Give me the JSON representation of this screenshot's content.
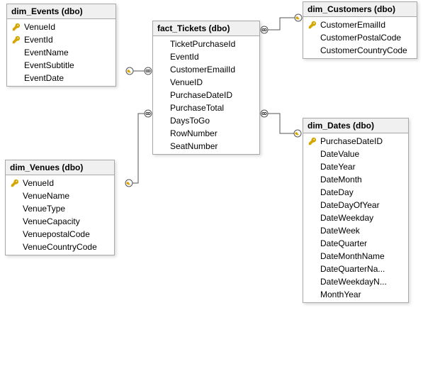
{
  "tables": {
    "events": {
      "title": "dim_Events (dbo)",
      "columns": [
        {
          "name": "VenueId",
          "pk": true
        },
        {
          "name": "EventId",
          "pk": true
        },
        {
          "name": "EventName",
          "pk": false
        },
        {
          "name": "EventSubtitle",
          "pk": false
        },
        {
          "name": "EventDate",
          "pk": false
        }
      ]
    },
    "tickets": {
      "title": "fact_Tickets (dbo)",
      "columns": [
        {
          "name": "TicketPurchaseId",
          "pk": false
        },
        {
          "name": "EventId",
          "pk": false
        },
        {
          "name": "CustomerEmailId",
          "pk": false
        },
        {
          "name": "VenueID",
          "pk": false
        },
        {
          "name": "PurchaseDateID",
          "pk": false
        },
        {
          "name": "PurchaseTotal",
          "pk": false
        },
        {
          "name": "DaysToGo",
          "pk": false
        },
        {
          "name": "RowNumber",
          "pk": false
        },
        {
          "name": "SeatNumber",
          "pk": false
        }
      ]
    },
    "customers": {
      "title": "dim_Customers (dbo)",
      "columns": [
        {
          "name": "CustomerEmailId",
          "pk": true
        },
        {
          "name": "CustomerPostalCode",
          "pk": false
        },
        {
          "name": "CustomerCountryCode",
          "pk": false
        }
      ]
    },
    "venues": {
      "title": "dim_Venues (dbo)",
      "columns": [
        {
          "name": "VenueId",
          "pk": true
        },
        {
          "name": "VenueName",
          "pk": false
        },
        {
          "name": "VenueType",
          "pk": false
        },
        {
          "name": "VenueCapacity",
          "pk": false
        },
        {
          "name": "VenuepostalCode",
          "pk": false
        },
        {
          "name": "VenueCountryCode",
          "pk": false
        }
      ]
    },
    "dates": {
      "title": "dim_Dates (dbo)",
      "columns": [
        {
          "name": "PurchaseDateID",
          "pk": true
        },
        {
          "name": "DateValue",
          "pk": false
        },
        {
          "name": "DateYear",
          "pk": false
        },
        {
          "name": "DateMonth",
          "pk": false
        },
        {
          "name": "DateDay",
          "pk": false
        },
        {
          "name": "DateDayOfYear",
          "pk": false
        },
        {
          "name": "DateWeekday",
          "pk": false
        },
        {
          "name": "DateWeek",
          "pk": false
        },
        {
          "name": "DateQuarter",
          "pk": false
        },
        {
          "name": "DateMonthName",
          "pk": false
        },
        {
          "name": "DateQuarterNa...",
          "pk": false
        },
        {
          "name": "DateWeekdayN...",
          "pk": false
        },
        {
          "name": "MonthYear",
          "pk": false
        }
      ]
    }
  },
  "relations": [
    {
      "from": "tickets",
      "to": "events"
    },
    {
      "from": "tickets",
      "to": "customers"
    },
    {
      "from": "tickets",
      "to": "venues"
    },
    {
      "from": "tickets",
      "to": "dates"
    }
  ],
  "chart_data": {
    "type": "table",
    "description": "Star-schema ER diagram: fact_Tickets in center linked to four dimension tables.",
    "tables": [
      {
        "name": "dim_Events",
        "schema": "dbo",
        "pk": [
          "VenueId",
          "EventId"
        ],
        "columns": [
          "VenueId",
          "EventId",
          "EventName",
          "EventSubtitle",
          "EventDate"
        ]
      },
      {
        "name": "fact_Tickets",
        "schema": "dbo",
        "pk": [],
        "columns": [
          "TicketPurchaseId",
          "EventId",
          "CustomerEmailId",
          "VenueID",
          "PurchaseDateID",
          "PurchaseTotal",
          "DaysToGo",
          "RowNumber",
          "SeatNumber"
        ]
      },
      {
        "name": "dim_Customers",
        "schema": "dbo",
        "pk": [
          "CustomerEmailId"
        ],
        "columns": [
          "CustomerEmailId",
          "CustomerPostalCode",
          "CustomerCountryCode"
        ]
      },
      {
        "name": "dim_Venues",
        "schema": "dbo",
        "pk": [
          "VenueId"
        ],
        "columns": [
          "VenueId",
          "VenueName",
          "VenueType",
          "VenueCapacity",
          "VenuepostalCode",
          "VenueCountryCode"
        ]
      },
      {
        "name": "dim_Dates",
        "schema": "dbo",
        "pk": [
          "PurchaseDateID"
        ],
        "columns": [
          "PurchaseDateID",
          "DateValue",
          "DateYear",
          "DateMonth",
          "DateDay",
          "DateDayOfYear",
          "DateWeekday",
          "DateWeek",
          "DateQuarter",
          "DateMonthName",
          "DateQuarterName",
          "DateWeekdayName",
          "MonthYear"
        ]
      }
    ],
    "relationships": [
      {
        "fromTable": "fact_Tickets",
        "toTable": "dim_Events",
        "type": "many-to-one"
      },
      {
        "fromTable": "fact_Tickets",
        "toTable": "dim_Customers",
        "type": "many-to-one"
      },
      {
        "fromTable": "fact_Tickets",
        "toTable": "dim_Venues",
        "type": "many-to-one"
      },
      {
        "fromTable": "fact_Tickets",
        "toTable": "dim_Dates",
        "type": "many-to-one"
      }
    ]
  }
}
